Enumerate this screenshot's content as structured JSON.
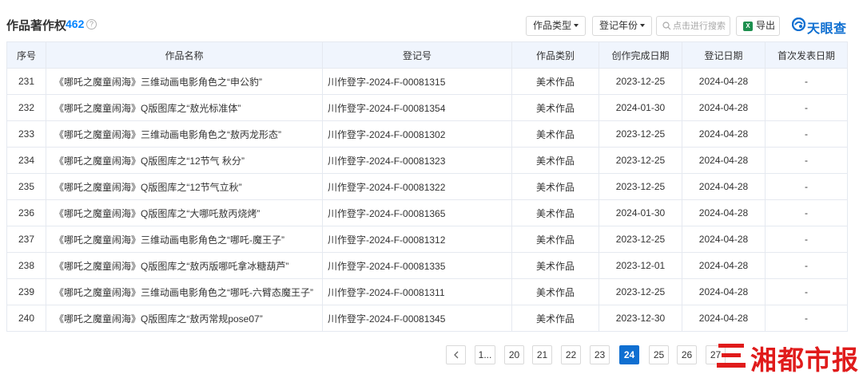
{
  "header": {
    "title": "作品著作权",
    "count": "462",
    "help_icon_glyph": "?",
    "filter_type_label": "作品类型",
    "filter_year_label": "登记年份",
    "search_placeholder": "点击进行搜索",
    "export_label": "导出",
    "excel_icon_glyph": "X",
    "logo_text": "天眼查"
  },
  "table": {
    "columns": [
      "序号",
      "作品名称",
      "登记号",
      "作品类别",
      "创作完成日期",
      "登记日期",
      "首次发表日期"
    ],
    "rows": [
      {
        "no": "231",
        "name": "《哪吒之魔童闹海》三维动画电影角色之“申公豹”",
        "reg": "川作登字-2024-F-00081315",
        "category": "美术作品",
        "completed": "2023-12-25",
        "registered": "2024-04-28",
        "published": "-"
      },
      {
        "no": "232",
        "name": "《哪吒之魔童闹海》Q版图库之“敖光标准体”",
        "reg": "川作登字-2024-F-00081354",
        "category": "美术作品",
        "completed": "2024-01-30",
        "registered": "2024-04-28",
        "published": "-"
      },
      {
        "no": "233",
        "name": "《哪吒之魔童闹海》三维动画电影角色之“敖丙龙形态”",
        "reg": "川作登字-2024-F-00081302",
        "category": "美术作品",
        "completed": "2023-12-25",
        "registered": "2024-04-28",
        "published": "-"
      },
      {
        "no": "234",
        "name": "《哪吒之魔童闹海》Q版图库之“12节气 秋分”",
        "reg": "川作登字-2024-F-00081323",
        "category": "美术作品",
        "completed": "2023-12-25",
        "registered": "2024-04-28",
        "published": "-"
      },
      {
        "no": "235",
        "name": "《哪吒之魔童闹海》Q版图库之“12节气立秋”",
        "reg": "川作登字-2024-F-00081322",
        "category": "美术作品",
        "completed": "2023-12-25",
        "registered": "2024-04-28",
        "published": "-"
      },
      {
        "no": "236",
        "name": "《哪吒之魔童闹海》Q版图库之“大哪吒敖丙烧烤”",
        "reg": "川作登字-2024-F-00081365",
        "category": "美术作品",
        "completed": "2024-01-30",
        "registered": "2024-04-28",
        "published": "-"
      },
      {
        "no": "237",
        "name": "《哪吒之魔童闹海》三维动画电影角色之“哪吒-魔王子”",
        "reg": "川作登字-2024-F-00081312",
        "category": "美术作品",
        "completed": "2023-12-25",
        "registered": "2024-04-28",
        "published": "-"
      },
      {
        "no": "238",
        "name": "《哪吒之魔童闹海》Q版图库之“敖丙版哪吒拿冰糖葫芦”",
        "reg": "川作登字-2024-F-00081335",
        "category": "美术作品",
        "completed": "2023-12-01",
        "registered": "2024-04-28",
        "published": "-"
      },
      {
        "no": "239",
        "name": "《哪吒之魔童闹海》三维动画电影角色之“哪吒-六臂态魔王子”",
        "reg": "川作登字-2024-F-00081311",
        "category": "美术作品",
        "completed": "2023-12-25",
        "registered": "2024-04-28",
        "published": "-"
      },
      {
        "no": "240",
        "name": "《哪吒之魔童闹海》Q版图库之“敖丙常规pose07”",
        "reg": "川作登字-2024-F-00081345",
        "category": "美术作品",
        "completed": "2023-12-30",
        "registered": "2024-04-28",
        "published": "-"
      }
    ]
  },
  "pagination": {
    "pages": [
      "1...",
      "20",
      "21",
      "22",
      "23",
      "24",
      "25",
      "26",
      "27"
    ],
    "current": "24"
  },
  "watermark": {
    "text": "湘都市报"
  },
  "colors": {
    "accent": "#0f6fd1",
    "count_blue": "#0084ff",
    "header_bg": "#f0f5fd",
    "watermark_red": "#e01b1b"
  }
}
